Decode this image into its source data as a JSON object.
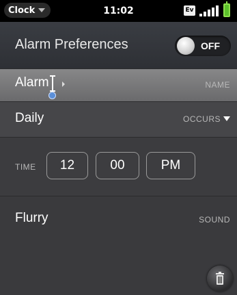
{
  "status_bar": {
    "app_name": "Clock",
    "time": "11:02",
    "network_label": "Ev",
    "battery_color": "#5cc12b"
  },
  "header": {
    "title": "Alarm Preferences",
    "toggle_state": "OFF"
  },
  "fields": {
    "name": {
      "value": "Alarm",
      "label": "NAME"
    },
    "occurs": {
      "value": "Daily",
      "label": "OCCURS"
    },
    "time": {
      "label": "TIME",
      "hour": "12",
      "minute": "00",
      "ampm": "PM"
    },
    "sound": {
      "value": "Flurry",
      "label": "SOUND"
    }
  },
  "icons": {
    "delete": "trash-icon",
    "cursor": "text-cursor-icon"
  }
}
